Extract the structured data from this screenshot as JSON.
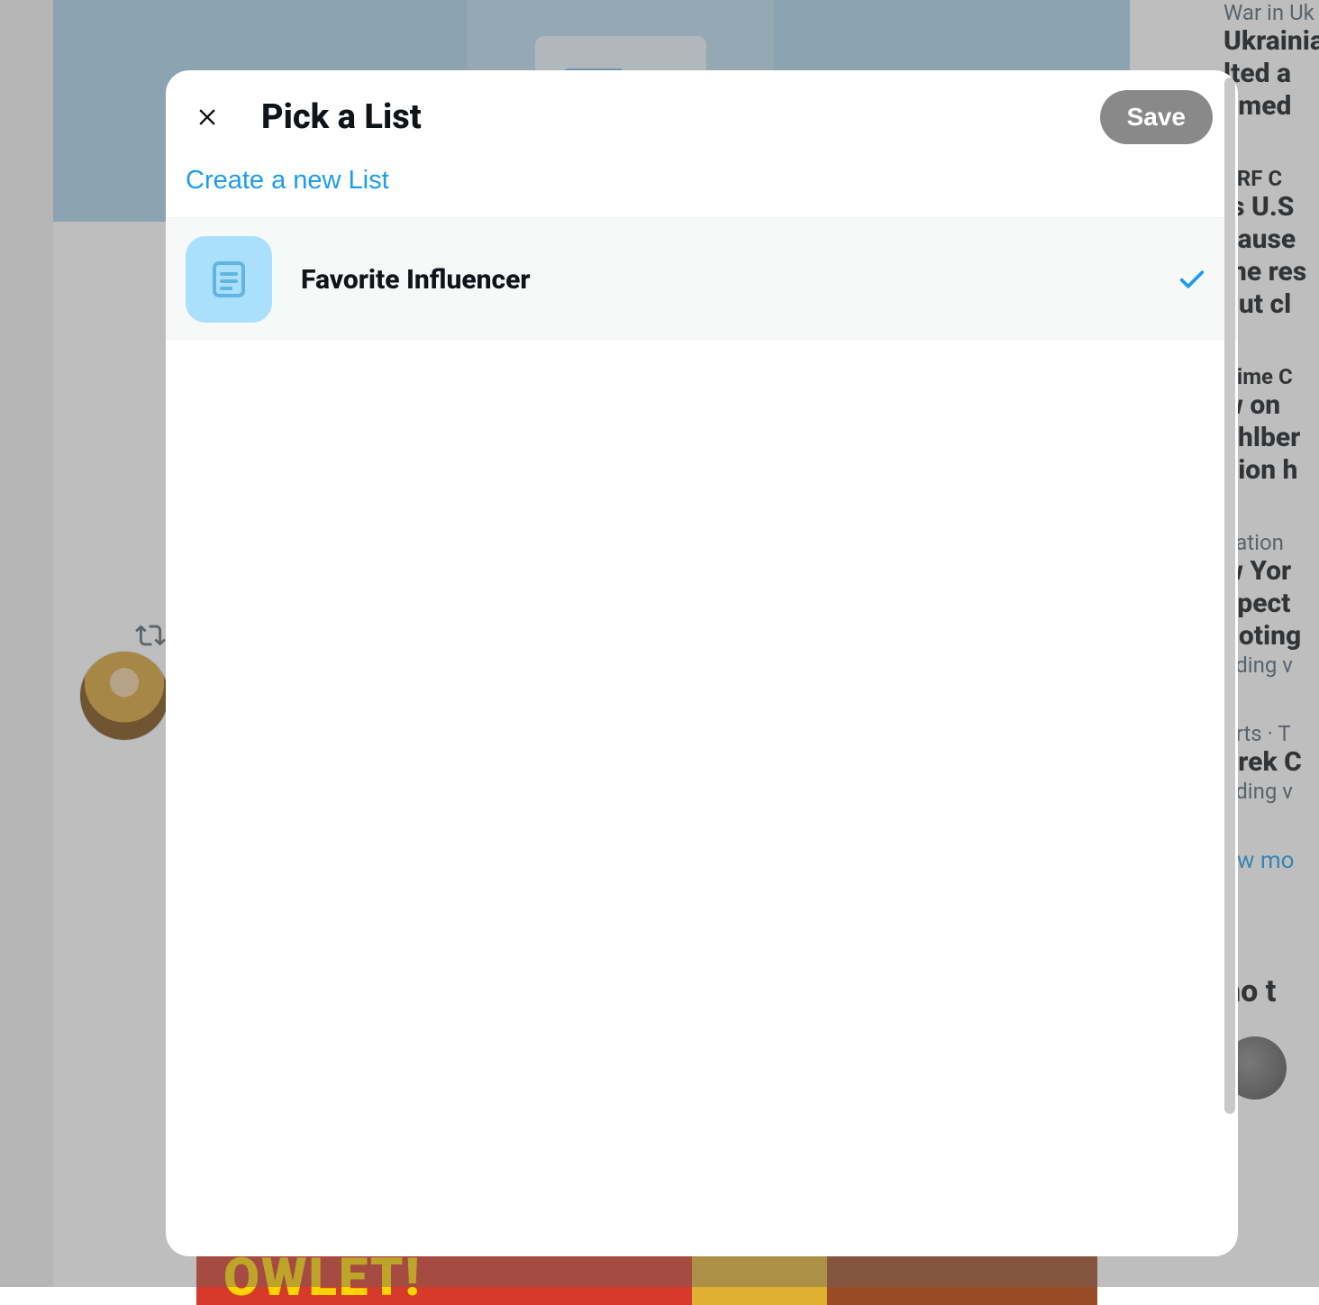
{
  "modal": {
    "title": "Pick a List",
    "save_label": "Save",
    "create_label": "Create a new List"
  },
  "lists": [
    {
      "name": "Favorite Influencer",
      "selected": true
    }
  ],
  "background": {
    "promo_text": "OWLET!",
    "trends": [
      {
        "meta": "War in Uk",
        "head": "Ukrainia\nlted a\nemed"
      },
      {
        "meta": "TRF C",
        "head": "is U.S\ncause\nme res\nout cl"
      },
      {
        "meta": "Time C",
        "head": "w on\nahlber\nllion h"
      },
      {
        "meta": "nation",
        "head": "w Yor\nspect\nooting",
        "sub": "nding v"
      },
      {
        "meta": "orts · T",
        "head": "erek C",
        "sub": "nding v"
      }
    ],
    "show_more": "ow mo",
    "who_to": "ho t"
  }
}
